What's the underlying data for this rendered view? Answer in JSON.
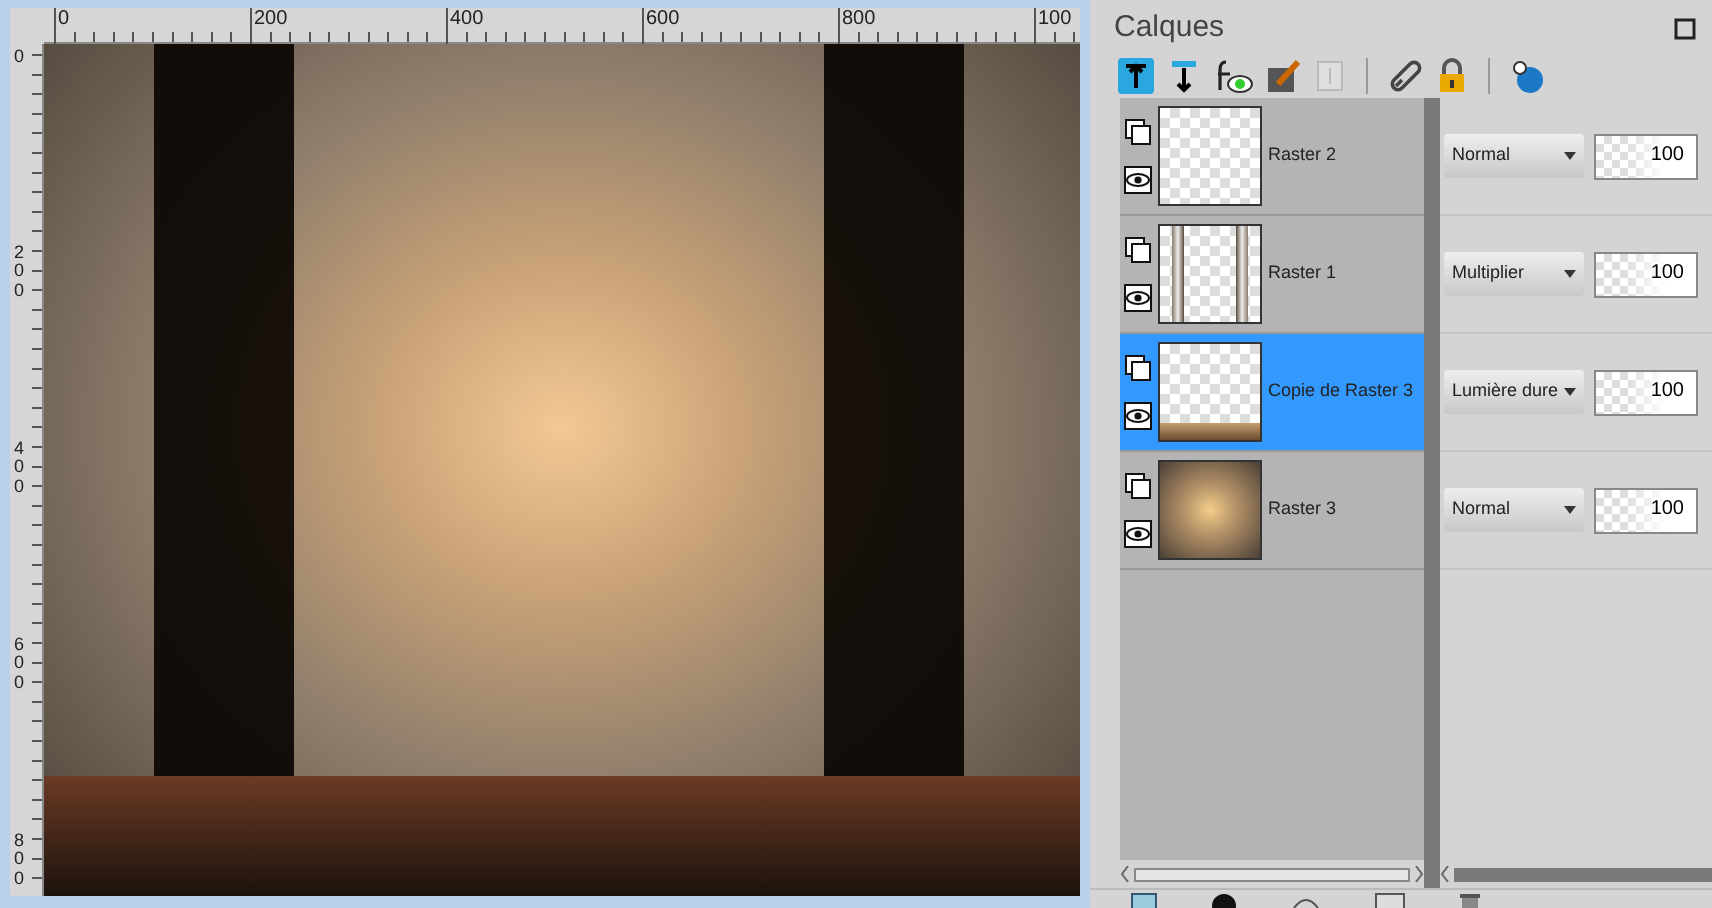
{
  "rulers": {
    "top_labels": [
      "0",
      "200",
      "400",
      "600",
      "800",
      "100"
    ],
    "left_labels": [
      "0",
      "200",
      "400",
      "600",
      "800"
    ]
  },
  "panel": {
    "title": "Calques"
  },
  "layers": [
    {
      "name": "Raster 2",
      "selected": false,
      "kind": "empty",
      "blend_mode": "Normal",
      "opacity": "100"
    },
    {
      "name": "Raster 1",
      "selected": false,
      "kind": "pillars",
      "blend_mode": "Multiplier",
      "opacity": "100"
    },
    {
      "name": "Copie de Raster 3",
      "selected": true,
      "kind": "floor",
      "blend_mode": "Lumière dure",
      "opacity": "100"
    },
    {
      "name": "Raster 3",
      "selected": false,
      "kind": "burst",
      "blend_mode": "Normal",
      "opacity": "100"
    }
  ]
}
